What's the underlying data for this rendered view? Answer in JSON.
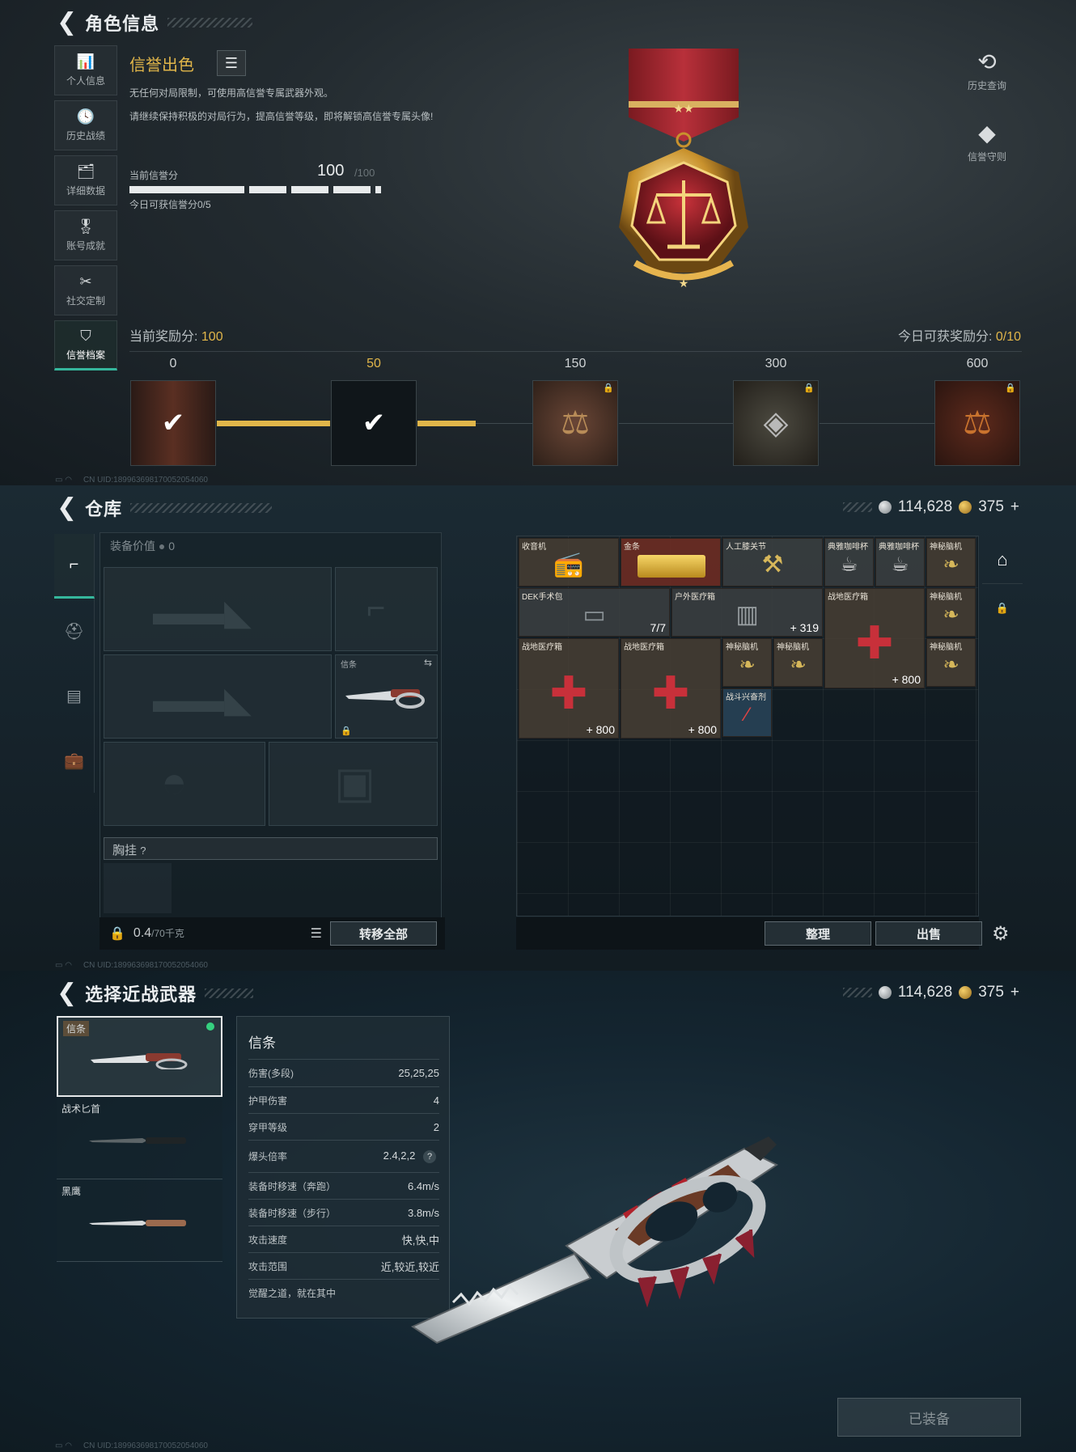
{
  "p1": {
    "title": "角色信息",
    "nav": [
      {
        "icon": "📊",
        "label": "个人信息"
      },
      {
        "icon": "🕓",
        "label": "历史战绩"
      },
      {
        "icon": "🗂",
        "label": "详细数据"
      },
      {
        "icon": "🎖",
        "label": "账号成就"
      },
      {
        "icon": "✂",
        "label": "社交定制"
      },
      {
        "icon": "⛉",
        "label": "信誉档案"
      }
    ],
    "rep_title": "信誉出色",
    "desc1": "无任何对局限制，可使用高信誉专属武器外观。",
    "desc2": "请继续保持积极的对局行为，提高信誉等级，即将解锁高信誉专属头像!",
    "score_label": "当前信誉分",
    "score": "100",
    "score_max": "/100",
    "today": "今日可获信誉分0/5",
    "history": "历史查询",
    "rules": "信誉守则",
    "reward_label": "当前奖励分:",
    "reward_value": "100",
    "today_reward_label": "今日可获奖励分:",
    "today_reward_value": "0/10",
    "milestones": [
      "0",
      "50",
      "150",
      "300",
      "600"
    ],
    "status": "CN UID:1899636981700520540​60"
  },
  "p2": {
    "title": "仓库",
    "silver": "114,628",
    "gold": "375",
    "plus": "+",
    "gear_value_label": "装备价值",
    "gear_value": "0",
    "knife_label": "信条",
    "chest_label": "胸挂",
    "weight": "0.4",
    "weight_max": "/70千克",
    "transfer": "转移全部",
    "sort": "整理",
    "sell": "出售",
    "items": [
      {
        "name": "收音机"
      },
      {
        "name": "金条"
      },
      {
        "name": "人工膝关节"
      },
      {
        "name": "典雅咖啡杯"
      },
      {
        "name": "典雅咖啡杯"
      },
      {
        "name": "神秘脑机"
      },
      {
        "name": "DEK手术包",
        "qty": "7/7"
      },
      {
        "name": "户外医疗箱",
        "qty": "319"
      },
      {
        "name": "战地医疗箱",
        "qty": "800"
      },
      {
        "name": "神秘脑机"
      },
      {
        "name": "战地医疗箱",
        "qty": "800"
      },
      {
        "name": "战地医疗箱",
        "qty": "800"
      },
      {
        "name": "神秘脑机"
      },
      {
        "name": "神秘脑机"
      },
      {
        "name": "神秘脑机"
      },
      {
        "name": "战斗兴奋剂"
      }
    ],
    "status": "CN UID:1899636981700520540​60"
  },
  "p3": {
    "title": "选择近战武器",
    "silver": "114,628",
    "gold": "375",
    "plus": "+",
    "weapons": [
      {
        "name": "信条"
      },
      {
        "name": "战术匕首"
      },
      {
        "name": "黑鹰"
      }
    ],
    "stats_title": "信条",
    "stats": [
      {
        "k": "伤害(多段)",
        "v": "25,25,25"
      },
      {
        "k": "护甲伤害",
        "v": "4"
      },
      {
        "k": "穿甲等级",
        "v": "2"
      },
      {
        "k": "爆头倍率",
        "v": "2.4,2,2"
      },
      {
        "k": "装备时移速（奔跑）",
        "v": "6.4m/s"
      },
      {
        "k": "装备时移速（步行）",
        "v": "3.8m/s"
      },
      {
        "k": "攻击速度",
        "v": "快,快,中"
      },
      {
        "k": "攻击范围",
        "v": "近,较近,较近"
      },
      {
        "k": "觉醒之道，就在其中",
        "v": ""
      }
    ],
    "equipped": "已装备",
    "status": "CN UID:1899636981700520540​60"
  },
  "colors": {
    "accent": "#35b79c",
    "gold": "#e1b64a"
  }
}
